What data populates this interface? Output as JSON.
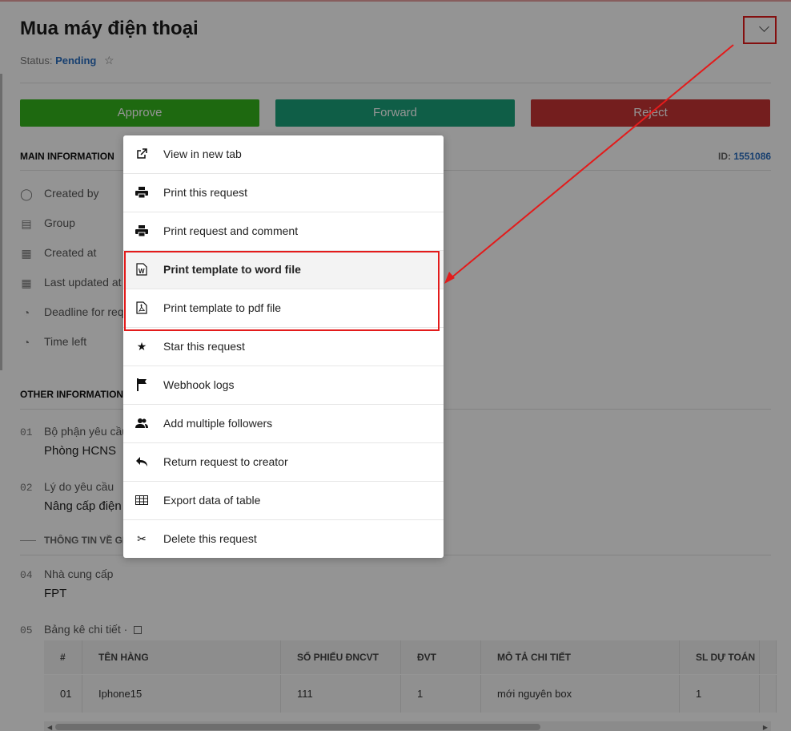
{
  "header": {
    "title": "Mua máy điện thoại",
    "status_label": "Status:",
    "status_value": "Pending"
  },
  "actions": {
    "approve": "Approve",
    "forward": "Forward",
    "reject": "Reject"
  },
  "main_info": {
    "title": "MAIN INFORMATION",
    "id_label": "ID:",
    "id_value": "1551086",
    "rows": [
      {
        "label": "Created by",
        "icon": "user-circle-icon"
      },
      {
        "label": "Group",
        "icon": "clipboard-icon"
      },
      {
        "label": "Created at",
        "icon": "calendar-icon"
      },
      {
        "label": "Last updated at",
        "icon": "calendar-icon"
      },
      {
        "label": "Deadline for req",
        "icon": "clock-icon"
      },
      {
        "label": "Time left",
        "icon": "clock-icon"
      }
    ]
  },
  "other_info": {
    "title": "OTHER INFORMATION",
    "fields": [
      {
        "num": "01",
        "label": "Bộ phận yêu cầu",
        "value": "Phòng HCNS"
      },
      {
        "num": "02",
        "label": "Lý do yêu cầu",
        "value": "Nâng cấp điện"
      },
      {
        "num": "04",
        "label": "Nhà cung cấp",
        "value": "FPT"
      }
    ],
    "group_title": "THÔNG TIN VỀ GIA",
    "table_field": {
      "num": "05",
      "label": "Bảng kê chi tiết ·"
    }
  },
  "table": {
    "headers": [
      "#",
      "TÊN HÀNG",
      "SỐ PHIẾU ĐNCVT",
      "ĐVT",
      "MÔ TẢ CHI TIẾT",
      "SL DỰ TOÁN"
    ],
    "rows": [
      [
        "01",
        "Iphone15",
        "111",
        "1",
        "mới nguyên box",
        "1"
      ]
    ]
  },
  "menu": {
    "items": [
      {
        "label": "View in new tab",
        "icon": "external-link-icon"
      },
      {
        "label": "Print this request",
        "icon": "printer-icon"
      },
      {
        "label": "Print request and comment",
        "icon": "printer-icon"
      },
      {
        "label": "Print template to word file",
        "icon": "word-file-icon"
      },
      {
        "label": "Print template to pdf file",
        "icon": "pdf-file-icon"
      },
      {
        "label": "Star this request",
        "icon": "star-icon"
      },
      {
        "label": "Webhook logs",
        "icon": "flag-icon"
      },
      {
        "label": "Add multiple followers",
        "icon": "users-icon"
      },
      {
        "label": "Return request to creator",
        "icon": "reply-icon"
      },
      {
        "label": "Export data of table",
        "icon": "table-icon"
      },
      {
        "label": "Delete this request",
        "icon": "scissors-icon"
      }
    ]
  },
  "colors": {
    "approve": "#35b51c",
    "forward": "#1aa37a",
    "reject": "#c93434",
    "link": "#2a6ec1",
    "highlight": "#e31b1b"
  }
}
